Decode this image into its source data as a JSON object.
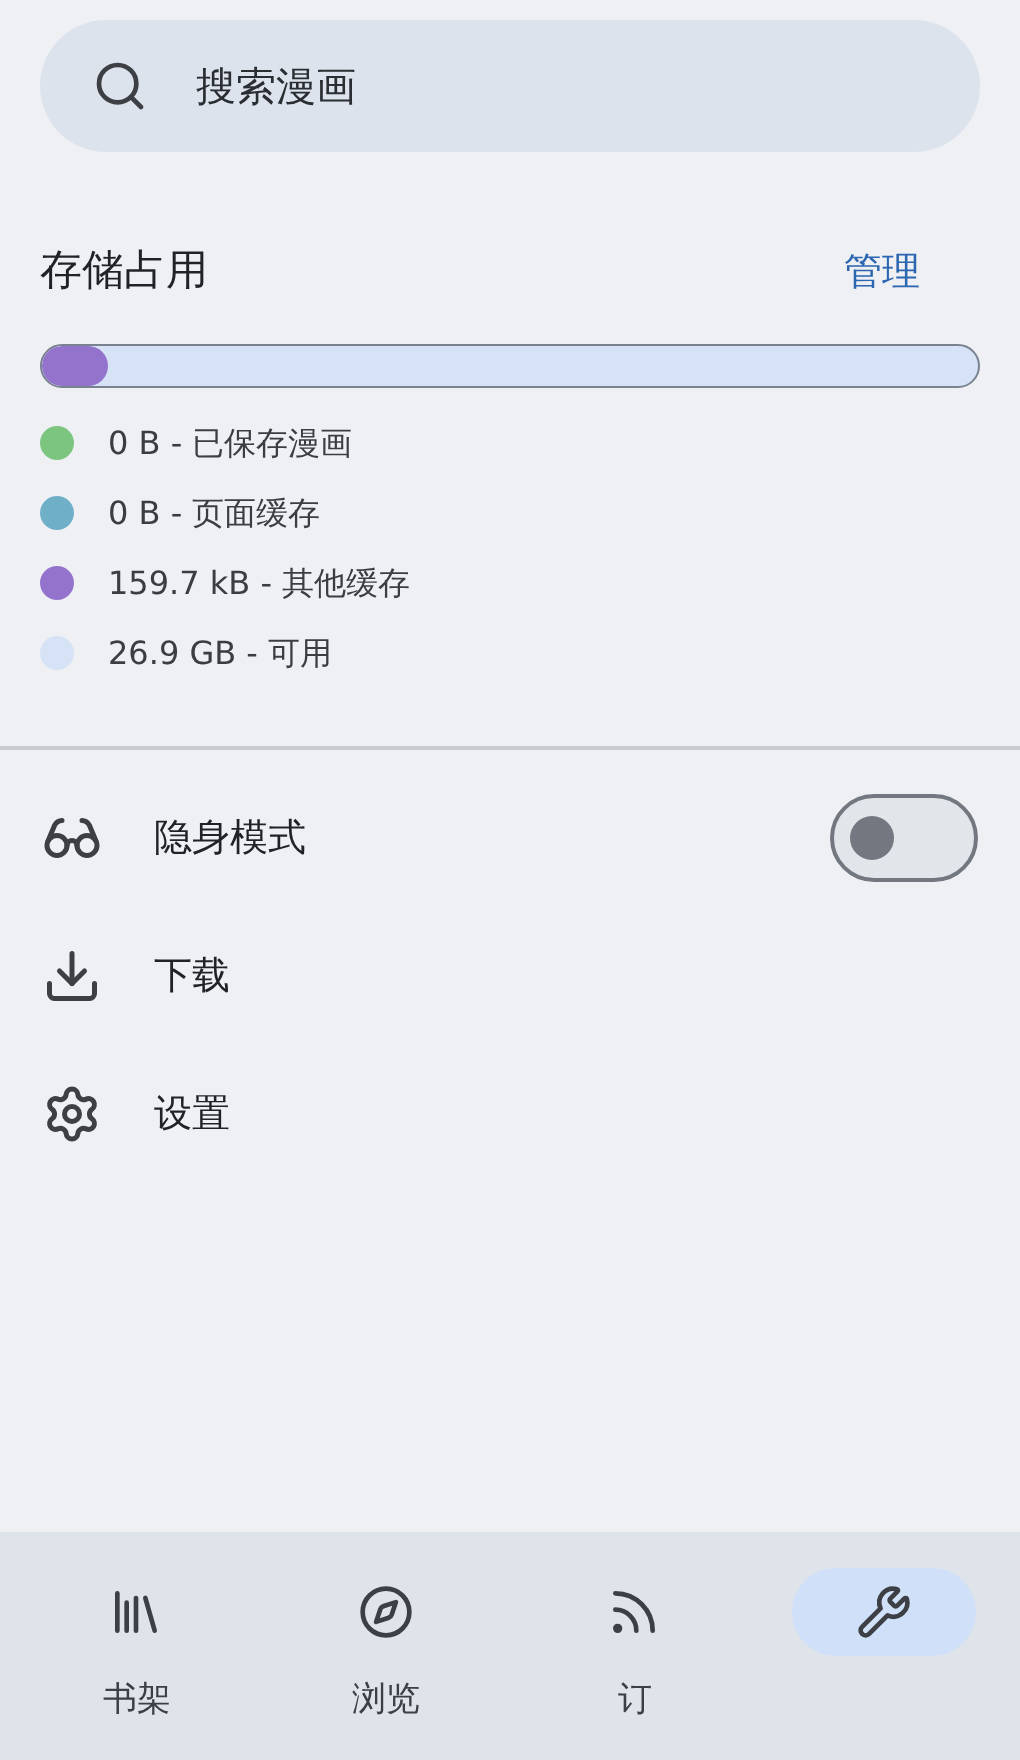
{
  "search": {
    "placeholder": "搜索漫画"
  },
  "storage": {
    "title": "存储占用",
    "manage": "管理",
    "level": 0.07,
    "legend": [
      {
        "text": "0 B - 已保存漫画",
        "color": "#7cc57f"
      },
      {
        "text": "0 B - 页面缓存",
        "color": "#6fb0c8"
      },
      {
        "text": "159.7 kB - 其他缓存",
        "color": "#9373cc"
      },
      {
        "text": "26.9 GB - 可用",
        "color": "#d6e3f6"
      }
    ]
  },
  "menu": [
    {
      "kind": "incognito",
      "label": "隐身模式",
      "on": false
    },
    {
      "kind": "download",
      "label": "下载"
    },
    {
      "kind": "settings",
      "label": "设置"
    }
  ],
  "nav": [
    {
      "kind": "library",
      "label": "书架",
      "selected": false
    },
    {
      "kind": "browse",
      "label": "浏览",
      "selected": false
    },
    {
      "kind": "feed",
      "label": "订",
      "selected": false
    },
    {
      "kind": "more",
      "selected": true
    }
  ]
}
